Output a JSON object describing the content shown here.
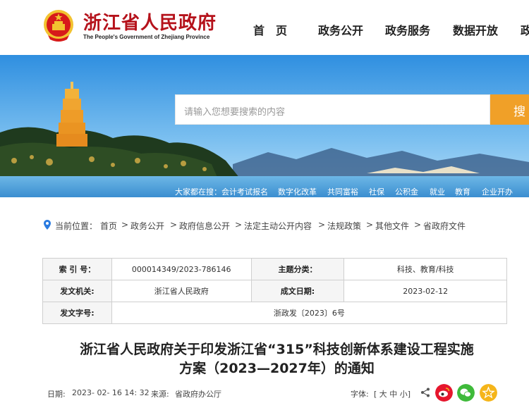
{
  "header": {
    "site_title": "浙江省人民政府",
    "site_subtitle": "The People's Government of Zhejiang Province",
    "nav": [
      "首　页",
      "政务公开",
      "政务服务",
      "数据开放",
      "政"
    ]
  },
  "search": {
    "placeholder": "请输入您想要搜索的内容",
    "button_label": "搜",
    "hot_prefix": "大家都在搜：",
    "hot_terms": [
      "会计考试报名",
      "数字化改革",
      "共同富裕",
      "社保",
      "公积金",
      "就业",
      "教育",
      "企业开办"
    ]
  },
  "breadcrumb": {
    "label": "当前位置：",
    "items": [
      "首页",
      "政务公开",
      "政府信息公开",
      "法定主动公开内容",
      "法规政策",
      "其他文件",
      "省政府文件"
    ],
    "separator": ">"
  },
  "info": {
    "index_label": "索 引 号：",
    "index_value": "000014349/2023-786146",
    "category_label": "主题分类：",
    "category_value": "科技、教育/科技",
    "issuer_label": "发文机关:",
    "issuer_value": "浙江省人民政府",
    "date_label": "成文日期:",
    "date_value": "2023-02-12",
    "docno_label": "发文字号:",
    "docno_value": "浙政发〔2023〕6号"
  },
  "article": {
    "title_line1": "浙江省人民政府关于印发浙江省“315”科技创新体系建设工程实施",
    "title_line2": "方案（2023—2027年）的通知"
  },
  "meta": {
    "date_label": "日期:",
    "date_value": "2023- 02- 16 14: 32",
    "source_label": "来源:",
    "source_value": "省政府办公厅",
    "font_label": "字体:",
    "font_sizes": "[ 大 中 小]"
  },
  "colors": {
    "brand_red": "#b5121b",
    "search_orange": "#f0a028",
    "weibo_red": "#e6162d",
    "wechat_green": "#3fba3a",
    "favorite_yellow": "#f5b51a"
  }
}
